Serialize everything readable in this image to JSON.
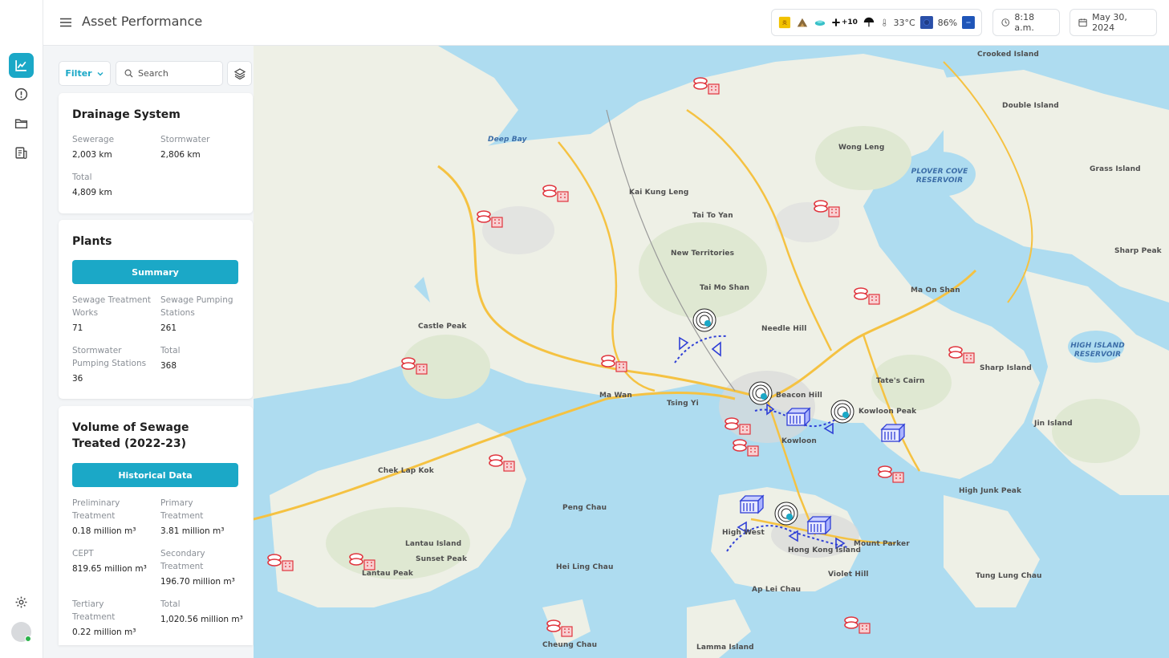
{
  "header": {
    "title": "Asset Performance",
    "time": "8:18 a.m.",
    "date": "May 30, 2024"
  },
  "weather": {
    "uv_label": "+10",
    "temperature": "33°C",
    "humidity": "86%"
  },
  "toolbar": {
    "filter_label": "Filter",
    "search_placeholder": "Search"
  },
  "drainage": {
    "title": "Drainage System",
    "sewerage_label": "Sewerage",
    "sewerage_value": "2,003 km",
    "stormwater_label": "Stormwater",
    "stormwater_value": "2,806 km",
    "total_label": "Total",
    "total_value": "4,809 km"
  },
  "plants": {
    "title": "Plants",
    "summary_button": "Summary",
    "stw_label": "Sewage Treatment Works",
    "stw_value": "71",
    "sps_label": "Sewage Pumping Stations",
    "sps_value": "261",
    "swps_label": "Stormwater Pumping Stations",
    "swps_value": "36",
    "total_label": "Total",
    "total_value": "368"
  },
  "volume": {
    "title": "Volume of Sewage Treated (2022-23)",
    "historical_button": "Historical Data",
    "preliminary_label": "Preliminary Treatment",
    "preliminary_value": "0.18 million m³",
    "primary_label": "Primary Treatment",
    "primary_value": "3.81 million m³",
    "cept_label": "CEPT",
    "cept_value": "819.65 million m³",
    "secondary_label": "Secondary Treatment",
    "secondary_value": "196.70 million m³",
    "tertiary_label": "Tertiary Treatment",
    "tertiary_value": "0.22 million m³",
    "total_label": "Total",
    "total_value": "1,020.56 million m³"
  },
  "map_places": {
    "crooked_island": "Crooked Island",
    "double_island": "Double Island",
    "deep_bay": "Deep Bay",
    "wong_leng": "Wong Leng",
    "plover_cove": "PLOVER COVE RESERVOIR",
    "grass_island": "Grass Island",
    "kai_kung_leng": "Kai Kung Leng",
    "tai_to_yan": "Tai To Yan",
    "new_territories": "New Territories",
    "sharp_peak": "Sharp Peak",
    "tai_mo_shan": "Tai Mo Shan",
    "ma_on_shan": "Ma On Shan",
    "castle_peak": "Castle Peak",
    "needle_hill": "Needle Hill",
    "high_island": "HIGH ISLAND RESERVOIR",
    "sharp_island": "Sharp Island",
    "tates_cairn": "Tate's Cairn",
    "ma_wan": "Ma Wan",
    "beacon_hill": "Beacon Hill",
    "tsing_yi": "Tsing Yi",
    "kowloon_peak": "Kowloon Peak",
    "jin_island": "Jin Island",
    "kowloon": "Kowloon",
    "chek_lap_kok": "Chek Lap Kok",
    "high_junk_peak": "High Junk Peak",
    "peng_chau": "Peng Chau",
    "lantau_island": "Lantau Island",
    "sunset_peak": "Sunset Peak",
    "hong_kong_island": "Hong Kong Island",
    "mount_parker": "Mount Parker",
    "high_west": "High West",
    "lantau_peak": "Lantau Peak",
    "hei_ling_chau": "Hei Ling Chau",
    "violet_hill": "Violet Hill",
    "tung_lung_chau": "Tung Lung Chau",
    "ap_lei_chau": "Ap Lei Chau",
    "cheung_chau": "Cheung Chau",
    "lamma_island": "Lamma Island"
  },
  "colors": {
    "accent": "#1ba8c7",
    "water": "#aedcf0",
    "land": "#eef0e6",
    "road": "#f5c242",
    "treatment_icon": "#e0333c",
    "pumping_icon": "#2f3fd6",
    "online_dot": "#2bb34a"
  }
}
